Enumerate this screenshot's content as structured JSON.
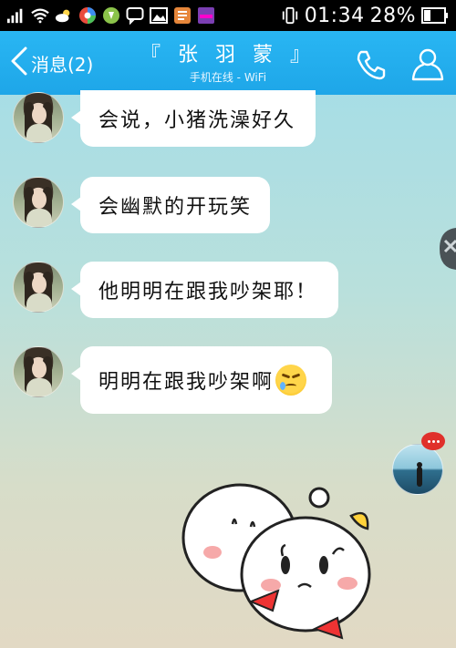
{
  "status_bar": {
    "time": "01:34",
    "battery": "28%",
    "icons": [
      "signal-icon",
      "wifi-icon",
      "weather-icon",
      "app-icon",
      "app-icon",
      "chat-icon",
      "image-icon",
      "app-icon",
      "app-icon",
      "vibrate-icon",
      "battery-icon"
    ]
  },
  "nav": {
    "back_label": "消息(2)",
    "title": "『 张 羽 蒙 』",
    "subtitle": "手机在线 - WiFi"
  },
  "messages": [
    {
      "text": "会说，小猪洗澡好久"
    },
    {
      "text": "会幽默的开玩笑"
    },
    {
      "text": "他明明在跟我吵架耶！"
    },
    {
      "text": "明明在跟我吵架啊"
    }
  ],
  "colors": {
    "nav_bg": "#1ea6e8",
    "status_bg": "#000000",
    "bubble_bg": "#ffffff",
    "badge": "#e0302b"
  }
}
